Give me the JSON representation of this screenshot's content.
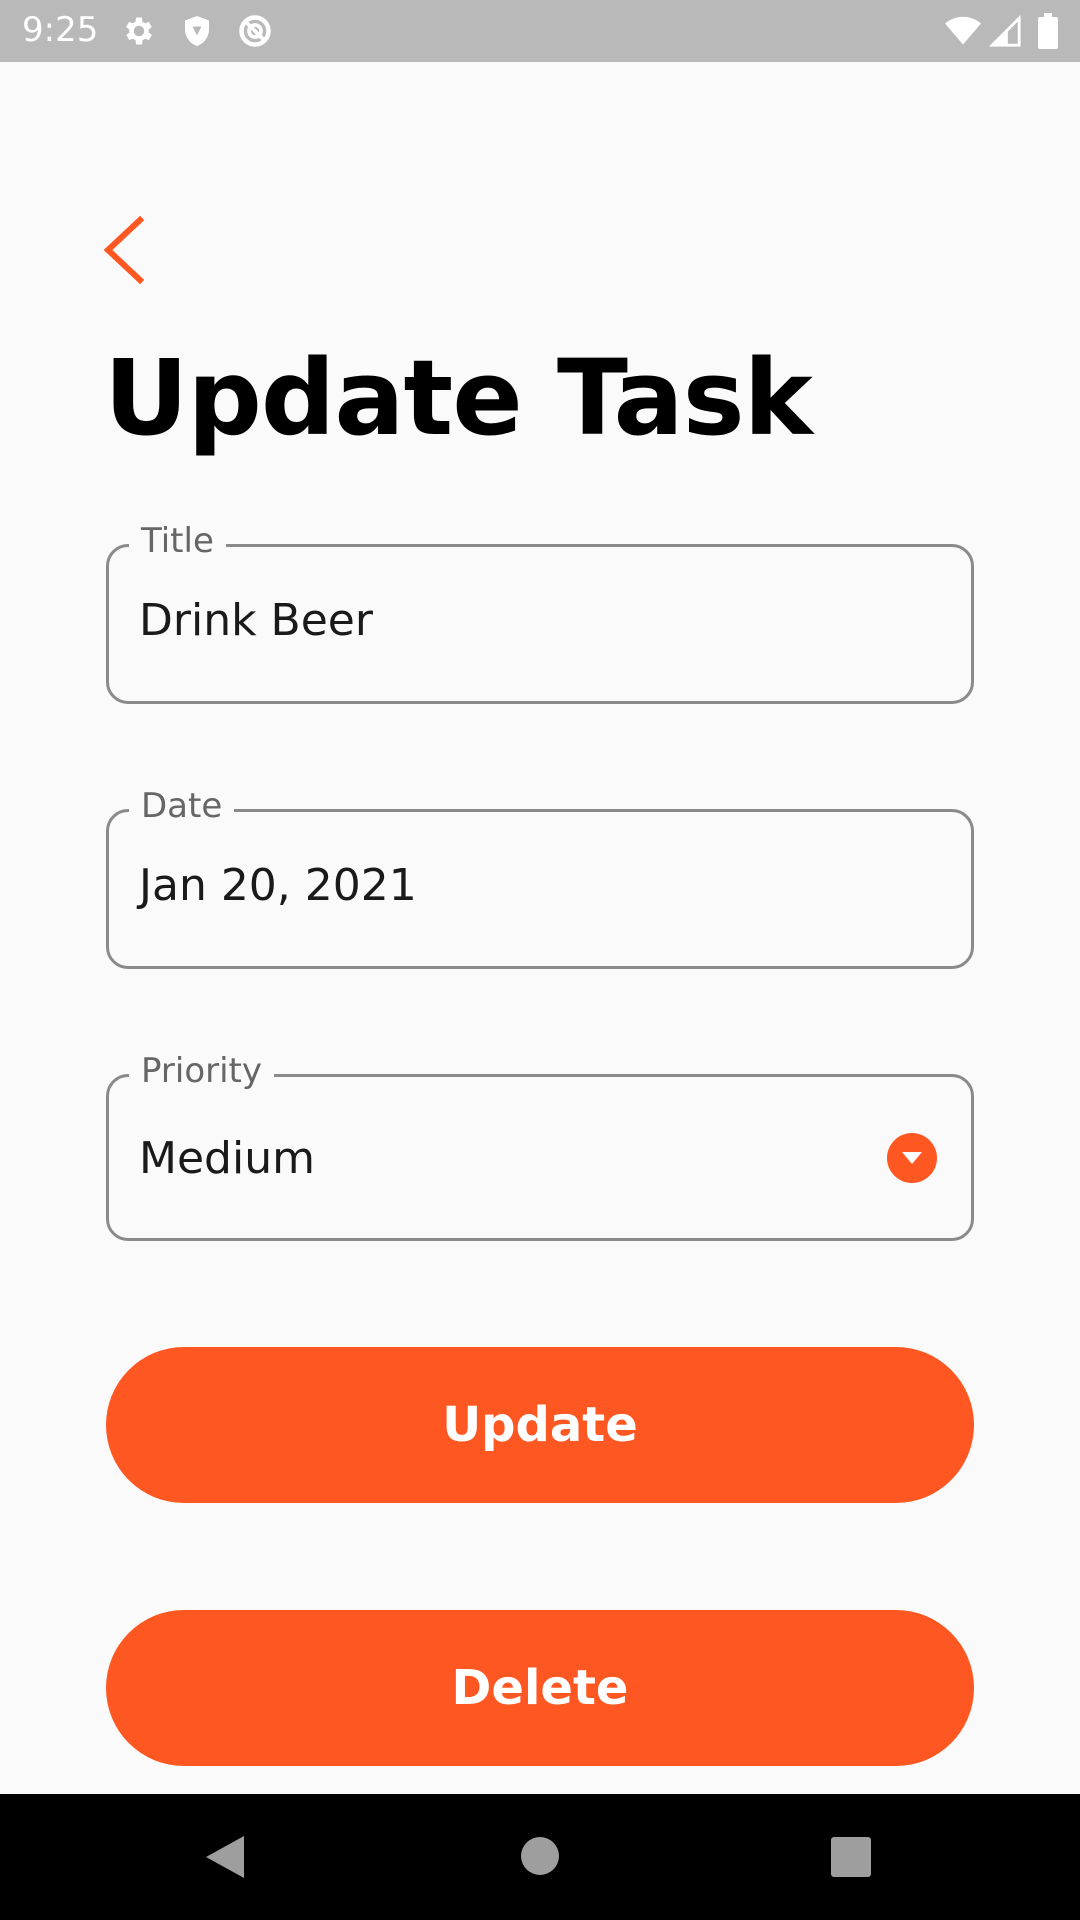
{
  "status_bar": {
    "time": "9:25",
    "icons": [
      "settings-icon",
      "shield-icon",
      "do-not-disturb-icon",
      "wifi-icon",
      "signal-icon",
      "battery-icon"
    ]
  },
  "header": {
    "back_icon": "chevron-left-icon",
    "title": "Update Task"
  },
  "form": {
    "title_field": {
      "label": "Title",
      "value": "Drink Beer"
    },
    "date_field": {
      "label": "Date",
      "value": "Jan 20, 2021"
    },
    "priority_field": {
      "label": "Priority",
      "value": "Medium",
      "icon": "dropdown-arrow-icon"
    }
  },
  "actions": {
    "update_label": "Update",
    "delete_label": "Delete"
  },
  "nav_bar": {
    "icons": [
      "back-icon",
      "home-icon",
      "recents-icon"
    ]
  },
  "colors": {
    "accent": "#ff5722",
    "status_bar": "#b9b9b9",
    "background": "#fafafa",
    "nav_bar": "#000000"
  }
}
